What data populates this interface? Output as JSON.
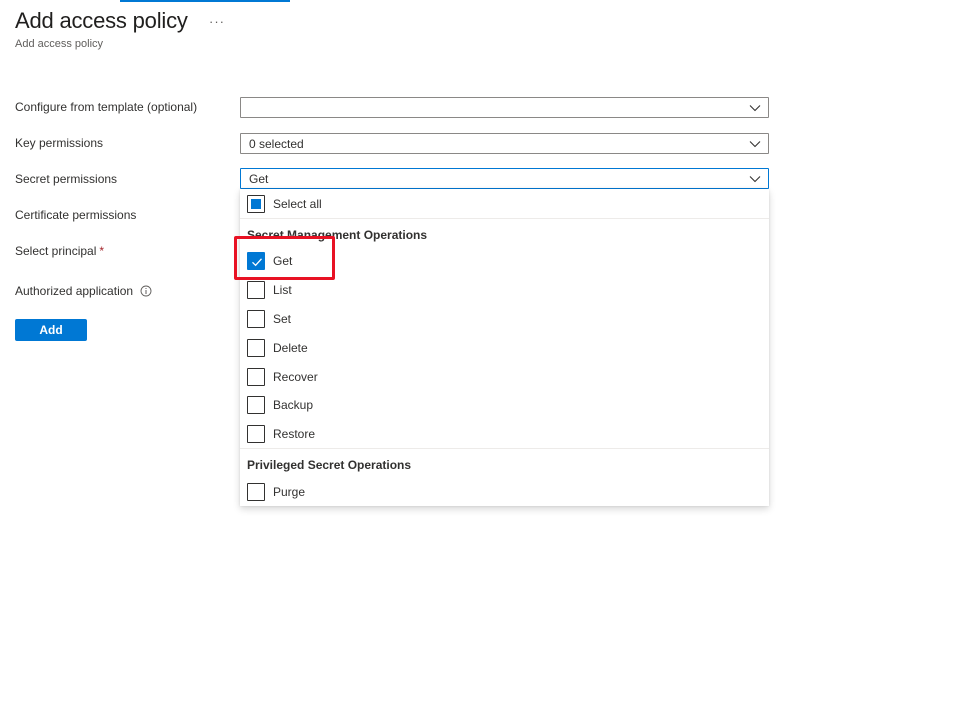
{
  "header": {
    "title": "Add access policy",
    "subtitle": "Add access policy",
    "more_label": "···"
  },
  "form": {
    "template": {
      "label": "Configure from template (optional)",
      "value": ""
    },
    "key_permissions": {
      "label": "Key permissions",
      "value": "0 selected"
    },
    "secret_permissions": {
      "label": "Secret permissions",
      "value": "Get"
    },
    "certificate_permissions": {
      "label": "Certificate permissions"
    },
    "principal": {
      "label": "Select principal",
      "required_mark": "*"
    },
    "authorized_application": {
      "label": "Authorized application"
    },
    "add_label": "Add"
  },
  "dropdown": {
    "select_all": {
      "label": "Select all",
      "state": "partial"
    },
    "groups": [
      {
        "title": "Secret Management Operations",
        "options": [
          {
            "label": "Get",
            "checked": true
          },
          {
            "label": "List",
            "checked": false
          },
          {
            "label": "Set",
            "checked": false
          },
          {
            "label": "Delete",
            "checked": false
          },
          {
            "label": "Recover",
            "checked": false
          },
          {
            "label": "Backup",
            "checked": false
          },
          {
            "label": "Restore",
            "checked": false
          }
        ]
      },
      {
        "title": "Privileged Secret Operations",
        "options": [
          {
            "label": "Purge",
            "checked": false
          }
        ]
      }
    ]
  },
  "colors": {
    "accent": "#0078d4",
    "highlight": "#e81123",
    "required": "#a4262c"
  }
}
